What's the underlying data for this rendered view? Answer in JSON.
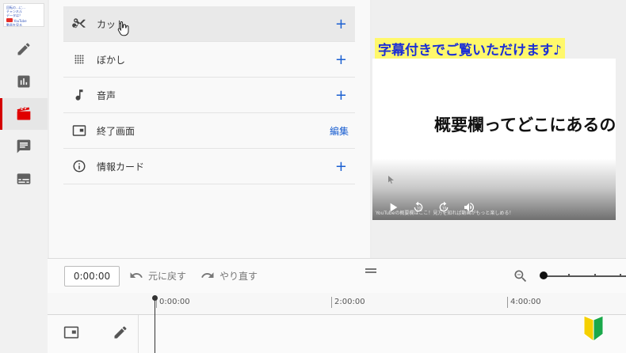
{
  "rail": {
    "thumbnail": {
      "line1": "回転の…に…",
      "line2": "チャンネル",
      "line3": "データは？",
      "badge": "YouTube",
      "footer": "動画を見る"
    },
    "items": [
      {
        "icon": "pencil-icon",
        "active": false
      },
      {
        "icon": "analytics-icon",
        "active": false
      },
      {
        "icon": "editor-clapper-icon",
        "active": true
      },
      {
        "icon": "comments-icon",
        "active": false
      },
      {
        "icon": "subtitles-icon",
        "active": false
      }
    ]
  },
  "tools": [
    {
      "label": "カット",
      "icon": "scissors-icon",
      "action": "+"
    },
    {
      "label": "ぼかし",
      "icon": "blur-icon",
      "action": "+"
    },
    {
      "label": "音声",
      "icon": "music-note-icon",
      "action": "+"
    },
    {
      "label": "終了画面",
      "icon": "end-screen-icon",
      "action": "編集"
    },
    {
      "label": "情報カード",
      "icon": "info-icon",
      "action": "+"
    }
  ],
  "preview": {
    "subtitle_banner": "字幕付きでご覧いただけます♪",
    "video_text": "概要欄ってどこにあるの",
    "caption": "YouTubeの概要欄はここ！見方を知れば動画がもっと楽しめる！"
  },
  "toolbar": {
    "timecode": "0:00:00",
    "undo_label": "元に戻す",
    "redo_label": "やり直す"
  },
  "ruler": {
    "ticks": [
      "0:00:00",
      "2:00:00",
      "4:00:00"
    ]
  },
  "colors": {
    "accent_blue": "#1a5fd1",
    "active_red": "#e00000",
    "banner_yellow": "#fff86b",
    "banner_text": "#1b2ed6"
  }
}
